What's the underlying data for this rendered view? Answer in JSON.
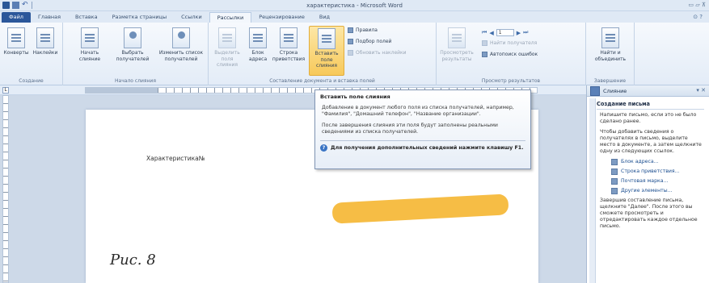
{
  "window": {
    "title": "характеристика - Microsoft Word",
    "controls": "▭ ▱ ⊼"
  },
  "tabs": [
    {
      "label": "Файл"
    },
    {
      "label": "Главная"
    },
    {
      "label": "Вставка"
    },
    {
      "label": "Разметка страницы"
    },
    {
      "label": "Ссылки"
    },
    {
      "label": "Рассылки"
    },
    {
      "label": "Рецензирование"
    },
    {
      "label": "Вид"
    }
  ],
  "ribbon": {
    "groups": {
      "create": {
        "label": "Создание",
        "envelopes": "Конверты",
        "labels": "Наклейки"
      },
      "start": {
        "label": "Начало слияния",
        "start_merge": "Начать слияние",
        "select_recipients": "Выбрать получателей",
        "edit_list": "Изменить список получателей"
      },
      "compose": {
        "label": "Составление документа и вставка полей",
        "highlight_fields": "Выделить поля слияния",
        "address_block": "Блок адреса",
        "greeting_line": "Строка приветствия",
        "insert_field": "Вставить поле слияния",
        "rules": "Правила",
        "match_fields": "Подбор полей",
        "update_labels": "Обновить наклейки"
      },
      "preview": {
        "label": "Просмотр результатов",
        "preview_results": "Просмотреть результаты",
        "record_number": "1",
        "find_recipient": "Найти получателя",
        "auto_check": "Автопоиск ошибок"
      },
      "finish": {
        "label": "Завершение",
        "finish_merge": "Найти и объединить"
      }
    }
  },
  "document": {
    "body_text": "Характеристика№",
    "figure_caption": "Рис. 8"
  },
  "tooltip": {
    "title": "Вставить поле слияния",
    "p1": "Добавление в документ любого поля из списка получателей, например, \"Фамилия\", \"Домашний телефон\", \"Название организации\".",
    "p2": "После завершения слияния эти поля будут заполнены реальными сведениями из списка получателей.",
    "help": "Для получения дополнительных сведений нажмите клавишу F1."
  },
  "taskpane": {
    "title": "Слияние",
    "heading": "Создание письма",
    "p1": "Напишите письмо, если это не было сделано ранее.",
    "p2": "Чтобы добавить сведения о получателях в письмо, выделите место в документе, а затем щелкните одну из следующих ссылок.",
    "links": [
      {
        "label": "Блок адреса..."
      },
      {
        "label": "Строка приветствия..."
      },
      {
        "label": "Почтовая марка..."
      },
      {
        "label": "Другие элементы..."
      }
    ],
    "p3": "Завершив составление письма, щелкните \"Далее\". После этого вы сможете просмотреть и отредактировать каждое отдельное письмо."
  },
  "colors": {
    "accent": "#2b579a",
    "highlight": "#f6b93b"
  }
}
